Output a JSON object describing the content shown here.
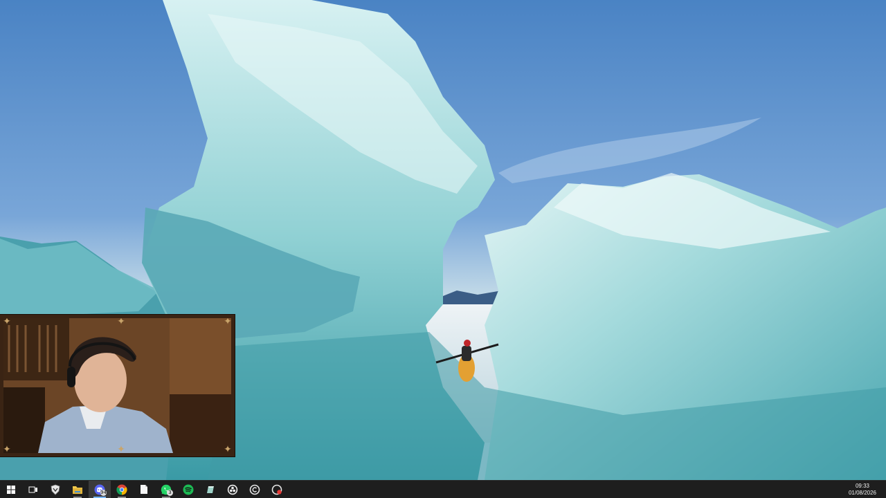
{
  "wallpaper": {
    "subject": "kayaker paddling between glacial icebergs",
    "colors": {
      "sky_top": "#4f86c6",
      "sky_horizon": "#c4dbe8",
      "ice_light": "#cfeef0",
      "ice_mid": "#7fc7cc",
      "ice_dark": "#2f8e9b",
      "water": "#dfe9ef"
    }
  },
  "webcam": {
    "frame_color": "#3a2414",
    "ornament_color": "#c9a46a",
    "corner_glyph": "✦"
  },
  "taskbar": {
    "background": "#1e1e1e",
    "buttons": [
      {
        "name": "start-button",
        "icon": "windows-logo-icon"
      },
      {
        "name": "task-view-button",
        "icon": "task-view-icon"
      },
      {
        "name": "app-shield-button",
        "icon": "shield-app-icon",
        "state": ""
      },
      {
        "name": "file-explorer-button",
        "icon": "folder-icon",
        "state": "running"
      },
      {
        "name": "discord-button",
        "icon": "discord-icon",
        "state": "active",
        "badge": "94"
      },
      {
        "name": "chrome-button",
        "icon": "chrome-icon",
        "state": "running"
      },
      {
        "name": "notepad-button",
        "icon": "document-icon",
        "state": ""
      },
      {
        "name": "whatsapp-button",
        "icon": "whatsapp-icon",
        "state": "running",
        "badge": "3"
      },
      {
        "name": "spotify-button",
        "icon": "spotify-icon",
        "state": ""
      },
      {
        "name": "editor-button",
        "icon": "editor-app-icon",
        "state": ""
      },
      {
        "name": "obs-button",
        "icon": "obs-icon",
        "state": ""
      },
      {
        "name": "clock-app-button",
        "icon": "circle-app-icon",
        "state": ""
      },
      {
        "name": "record-app-button",
        "icon": "record-app-icon",
        "state": ""
      }
    ],
    "clock": {
      "time": "09:33",
      "date": "01/08/2026"
    }
  }
}
